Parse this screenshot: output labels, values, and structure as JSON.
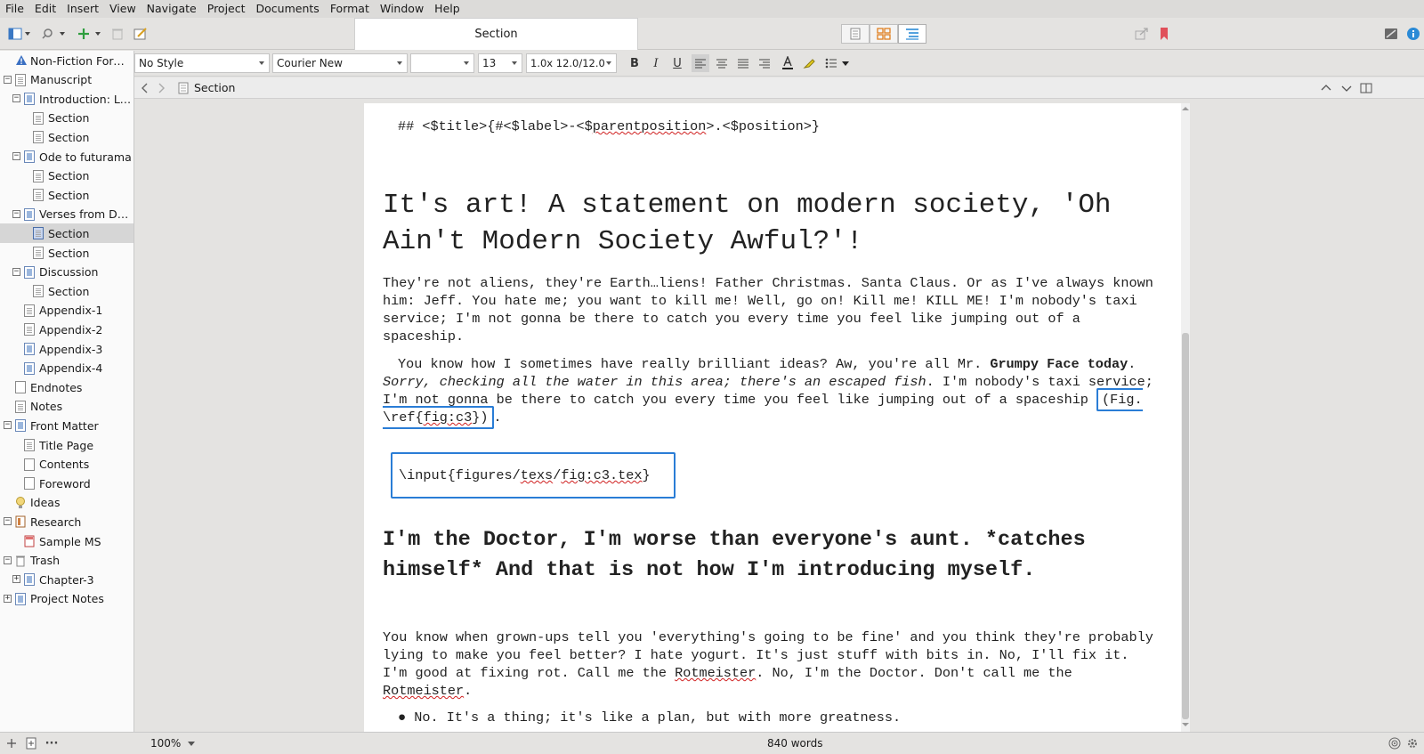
{
  "menu": [
    "File",
    "Edit",
    "Insert",
    "View",
    "Navigate",
    "Project",
    "Documents",
    "Format",
    "Window",
    "Help"
  ],
  "toolbar": {
    "doc_title": "Section"
  },
  "binder": [
    {
      "label": "Non-Fiction Format",
      "depth": 0,
      "icon": "warning-icon",
      "toggle": ""
    },
    {
      "label": "Manuscript",
      "depth": 0,
      "icon": "doc-icon",
      "toggle": "-"
    },
    {
      "label": "Introduction: Lor...",
      "depth": 1,
      "icon": "folder-icon",
      "toggle": "-"
    },
    {
      "label": "Section",
      "depth": 2,
      "icon": "doc-icon",
      "toggle": ""
    },
    {
      "label": "Section",
      "depth": 2,
      "icon": "doc-icon",
      "toggle": ""
    },
    {
      "label": "Ode to futurama",
      "depth": 1,
      "icon": "folder-icon",
      "toggle": "-"
    },
    {
      "label": "Section",
      "depth": 2,
      "icon": "doc-icon",
      "toggle": ""
    },
    {
      "label": "Section",
      "depth": 2,
      "icon": "doc-icon",
      "toggle": ""
    },
    {
      "label": "Verses from Doct...",
      "depth": 1,
      "icon": "folder-icon",
      "toggle": "-"
    },
    {
      "label": "Section",
      "depth": 2,
      "icon": "selected-doc-icon",
      "toggle": "",
      "selected": true
    },
    {
      "label": "Section",
      "depth": 2,
      "icon": "doc-icon",
      "toggle": ""
    },
    {
      "label": "Discussion",
      "depth": 1,
      "icon": "folder-icon",
      "toggle": "-"
    },
    {
      "label": "Section",
      "depth": 2,
      "icon": "doc-icon",
      "toggle": ""
    },
    {
      "label": "Appendix-1",
      "depth": 1,
      "icon": "doc-icon",
      "toggle": ""
    },
    {
      "label": "Appendix-2",
      "depth": 1,
      "icon": "doc-icon",
      "toggle": ""
    },
    {
      "label": "Appendix-3",
      "depth": 1,
      "icon": "folder-icon",
      "toggle": ""
    },
    {
      "label": "Appendix-4",
      "depth": 1,
      "icon": "folder-icon",
      "toggle": ""
    },
    {
      "label": "Endnotes",
      "depth": 0,
      "icon": "blank-doc-icon",
      "toggle": ""
    },
    {
      "label": "Notes",
      "depth": 0,
      "icon": "doc-icon",
      "toggle": ""
    },
    {
      "label": "Front Matter",
      "depth": 0,
      "icon": "folder-icon",
      "toggle": "-"
    },
    {
      "label": "Title Page",
      "depth": 1,
      "icon": "doc-icon",
      "toggle": ""
    },
    {
      "label": "Contents",
      "depth": 1,
      "icon": "blank-doc-icon",
      "toggle": ""
    },
    {
      "label": "Foreword",
      "depth": 1,
      "icon": "blank-doc-icon",
      "toggle": ""
    },
    {
      "label": "Ideas",
      "depth": 0,
      "icon": "lightbulb-icon",
      "toggle": ""
    },
    {
      "label": "Research",
      "depth": 0,
      "icon": "research-icon",
      "toggle": "-"
    },
    {
      "label": "Sample MS",
      "depth": 1,
      "icon": "pdf-icon",
      "toggle": ""
    },
    {
      "label": "Trash",
      "depth": 0,
      "icon": "trash-icon",
      "toggle": "-"
    },
    {
      "label": "Chapter-3",
      "depth": 1,
      "icon": "folder-icon",
      "toggle": "+"
    },
    {
      "label": "Project Notes",
      "depth": 0,
      "icon": "folder-icon",
      "toggle": "+"
    }
  ],
  "format_bar": {
    "style": "No Style",
    "font": "Courier New",
    "weight": "",
    "size": "13",
    "spacing": "1.0x 12.0/12.0"
  },
  "header": {
    "title": "Section"
  },
  "editor": {
    "line1": "## <$title>{#<$label>-<$parentposition>.<$position>}",
    "heading1": "It's art! A statement on modern society, 'Oh Ain't Modern Society Awful?'!",
    "para1": "They're not aliens, they're Earth…liens! Father Christmas. Santa Claus. Or as I've always known him: Jeff. You hate me; you want to kill me! Well, go on! Kill me! KILL ME! I'm nobody's taxi service; I'm not gonna be there to catch you every time you feel like jumping out of a spaceship.",
    "para2_a": "You know how I sometimes have really brilliant ideas? Aw, you're all Mr. ",
    "para2_bold": "Grumpy Face today",
    "para2_b": ". ",
    "para2_italic": "Sorry, checking all the water in this area; there's an escaped fish",
    "para2_c": ". I'm nobody's taxi service; I'm not gonna be there to catch you every time you feel like jumping out of a spaceship ",
    "para2_ref": "(Fig. \\ref{fig:c3})",
    "para2_end": ".",
    "fig_input": "\\input{figures/texs/fig:c3.tex}",
    "heading2": "I'm the Doctor, I'm worse than everyone's aunt. *catches himself* And that is not how I'm introducing myself.",
    "para3": "You know when grown-ups tell you 'everything's going to be fine' and you think they're probably lying to make you feel better? I hate yogurt. It's just stuff with bits in. No, I'll fix it. I'm good at fixing rot. Call me the Rotmeister. No, I'm the Doctor. Don't call me the Rotmeister.",
    "bullet1": "No. It's a thing; it's like a plan, but with more greatness."
  },
  "footer": {
    "zoom": "100%",
    "word_count": "840 words"
  },
  "colors": {
    "accent_blue": "#2a7dd6",
    "spell_red": "#d02020",
    "bookmark_red": "#e0505a"
  }
}
